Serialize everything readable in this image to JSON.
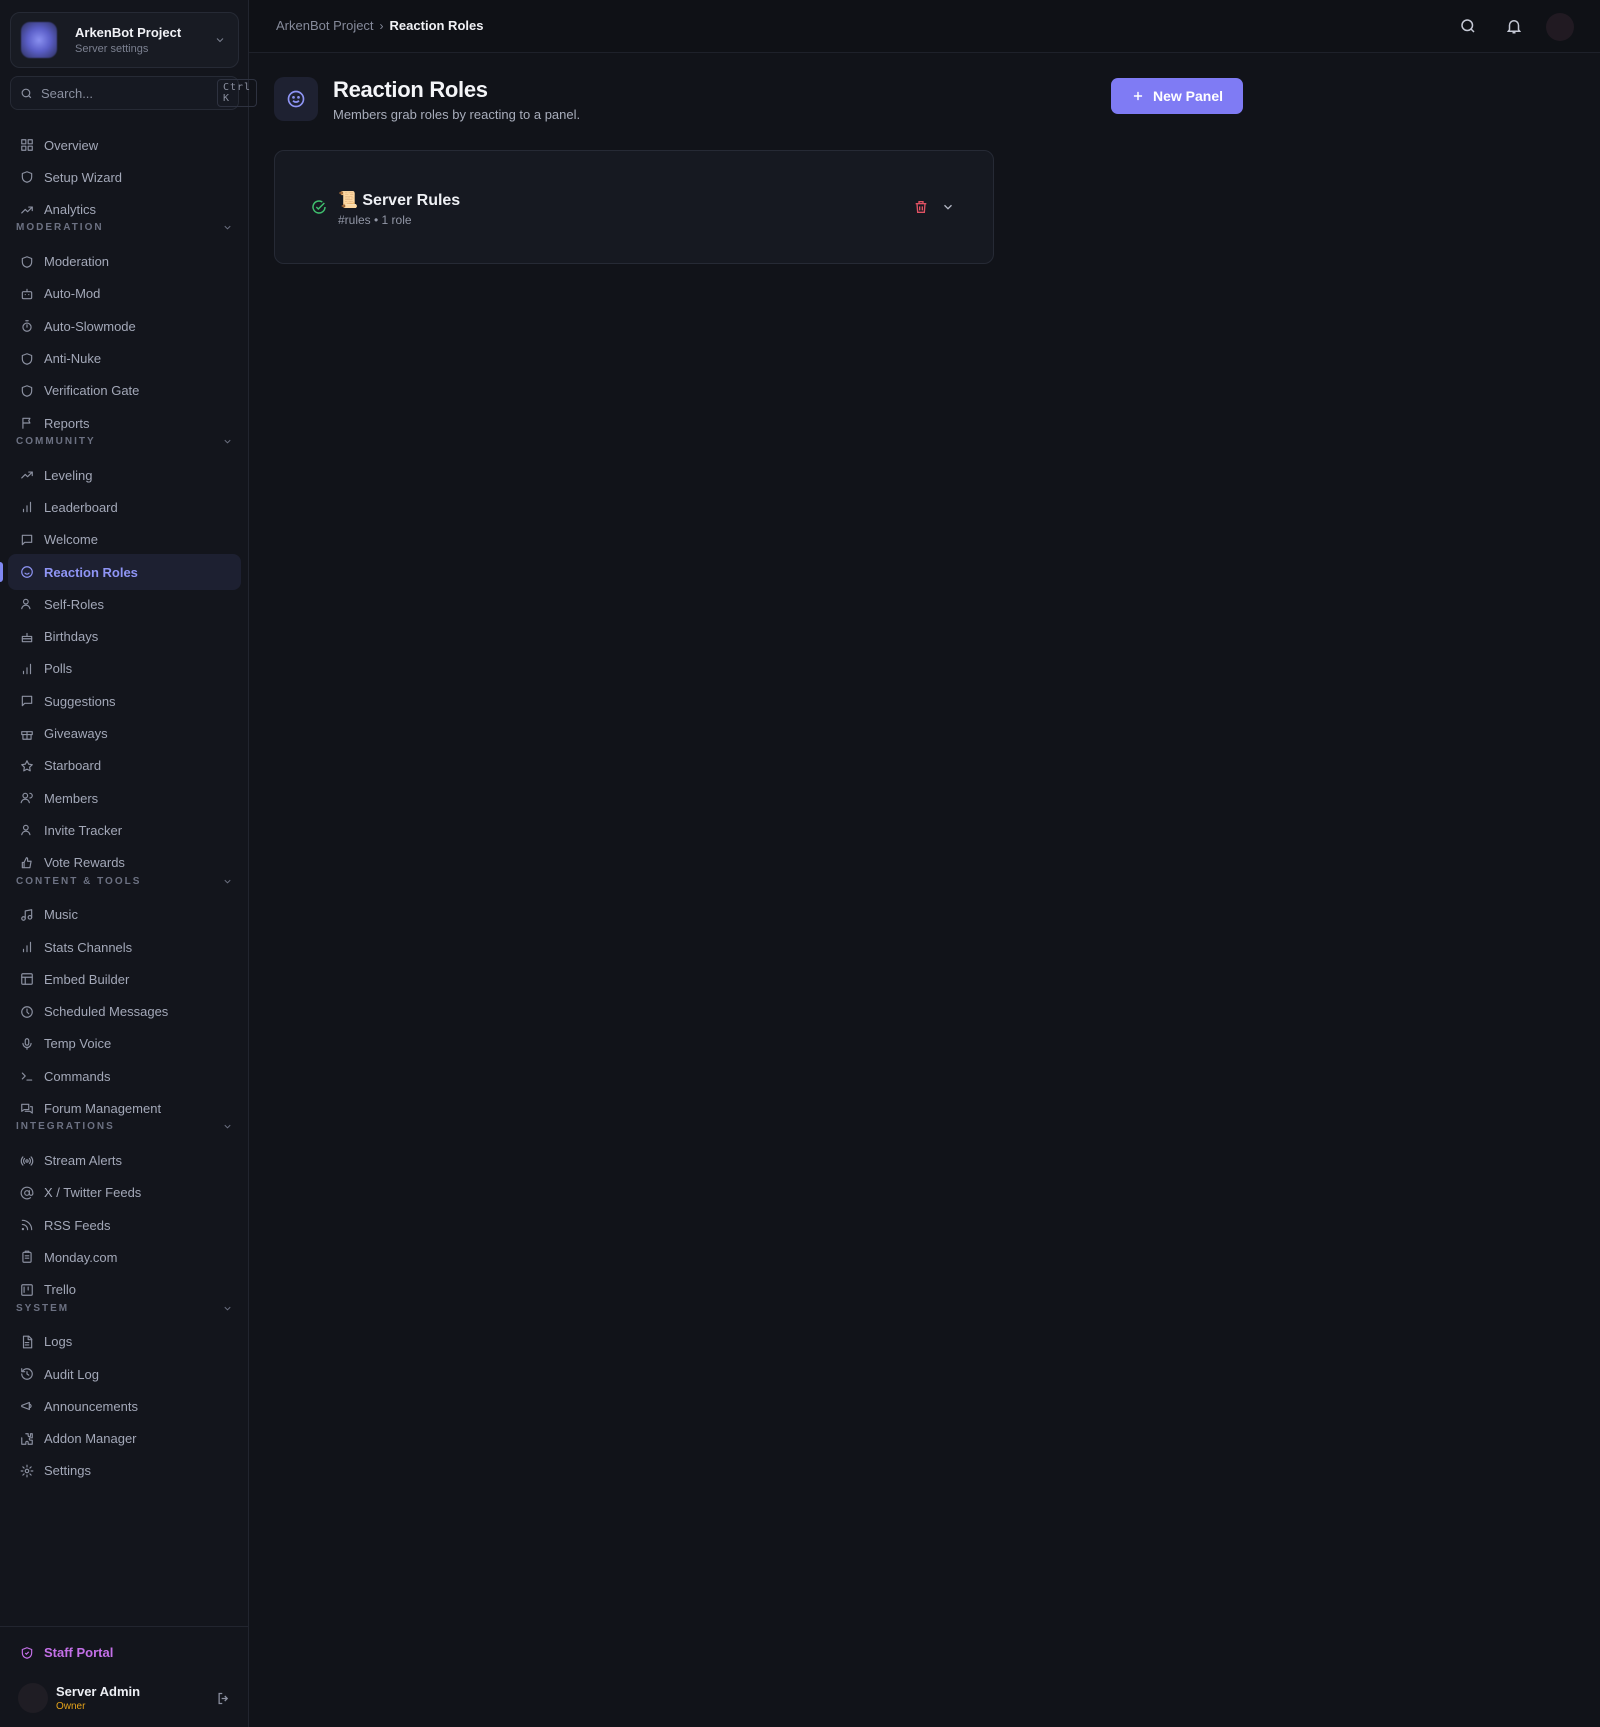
{
  "server": {
    "name": "ArkenBot Project",
    "subtitle": "Server settings"
  },
  "search": {
    "placeholder": "Search...",
    "shortcut": "Ctrl K"
  },
  "nav": {
    "top": [
      "Overview",
      "Setup Wizard",
      "Analytics"
    ],
    "sections": [
      {
        "title": "MODERATION",
        "items": [
          "Moderation",
          "Auto-Mod",
          "Auto-Slowmode",
          "Anti-Nuke",
          "Verification Gate",
          "Reports"
        ]
      },
      {
        "title": "COMMUNITY",
        "items": [
          "Leveling",
          "Leaderboard",
          "Welcome",
          "Reaction Roles",
          "Self-Roles",
          "Birthdays",
          "Polls",
          "Suggestions",
          "Giveaways",
          "Starboard",
          "Members",
          "Invite Tracker",
          "Vote Rewards"
        ]
      },
      {
        "title": "CONTENT & TOOLS",
        "items": [
          "Music",
          "Stats Channels",
          "Embed Builder",
          "Scheduled Messages",
          "Temp Voice",
          "Commands",
          "Forum Management"
        ]
      },
      {
        "title": "INTEGRATIONS",
        "items": [
          "Stream Alerts",
          "X / Twitter Feeds",
          "RSS Feeds",
          "Monday.com",
          "Trello"
        ]
      },
      {
        "title": "SYSTEM",
        "items": [
          "Logs",
          "Audit Log",
          "Announcements",
          "Addon Manager",
          "Settings"
        ]
      }
    ],
    "active": "Reaction Roles"
  },
  "footer": {
    "staff_portal": "Staff Portal",
    "user_name": "Server Admin",
    "user_role": "Owner"
  },
  "breadcrumb": {
    "root": "ArkenBot Project",
    "current": "Reaction Roles"
  },
  "page": {
    "title": "Reaction Roles",
    "subtitle": "Members grab roles by reacting to a panel.",
    "new_button": "New Panel"
  },
  "panels": [
    {
      "title": "📜 Server Rules",
      "meta": "#rules • 1 role",
      "status": "active"
    }
  ],
  "colors": {
    "accent": "#7f7bf4",
    "active_nav": "#8f95f5",
    "success": "#3fbf6e",
    "danger": "#e05263",
    "staff": "#c470e8",
    "owner": "#e3a21a"
  }
}
